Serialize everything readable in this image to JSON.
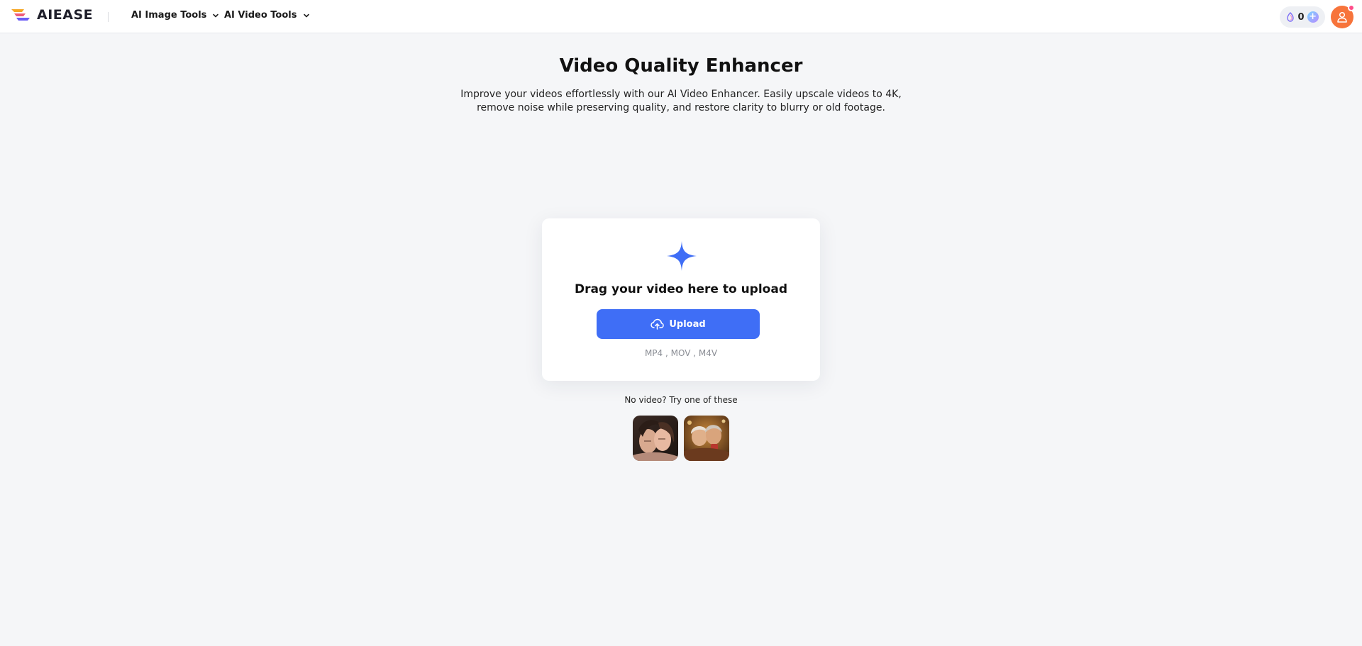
{
  "header": {
    "brand": "AIEASE",
    "nav": [
      {
        "label": "AI Image Tools"
      },
      {
        "label": "AI Video Tools"
      }
    ],
    "credits": {
      "count": "0",
      "plus": "+"
    }
  },
  "main": {
    "title": "Video Quality Enhancer",
    "description": "Improve your videos effortlessly with our AI Video Enhancer. Easily upscale videos to 4K, remove noise while preserving quality, and restore clarity to blurry or old footage.",
    "upload": {
      "drag_text": "Drag your video here to upload",
      "button_label": "Upload",
      "formats": "MP4 , MOV , M4V"
    },
    "samples": {
      "prompt": "No video? Try one of these"
    }
  },
  "colors": {
    "accent": "#3f6ef6",
    "avatar": "#f7743b",
    "background": "#f5f6f8"
  },
  "icons": [
    "chevron-down-icon",
    "gem-icon",
    "plus-icon",
    "user-icon",
    "sparkle-icon",
    "cloud-upload-icon"
  ]
}
